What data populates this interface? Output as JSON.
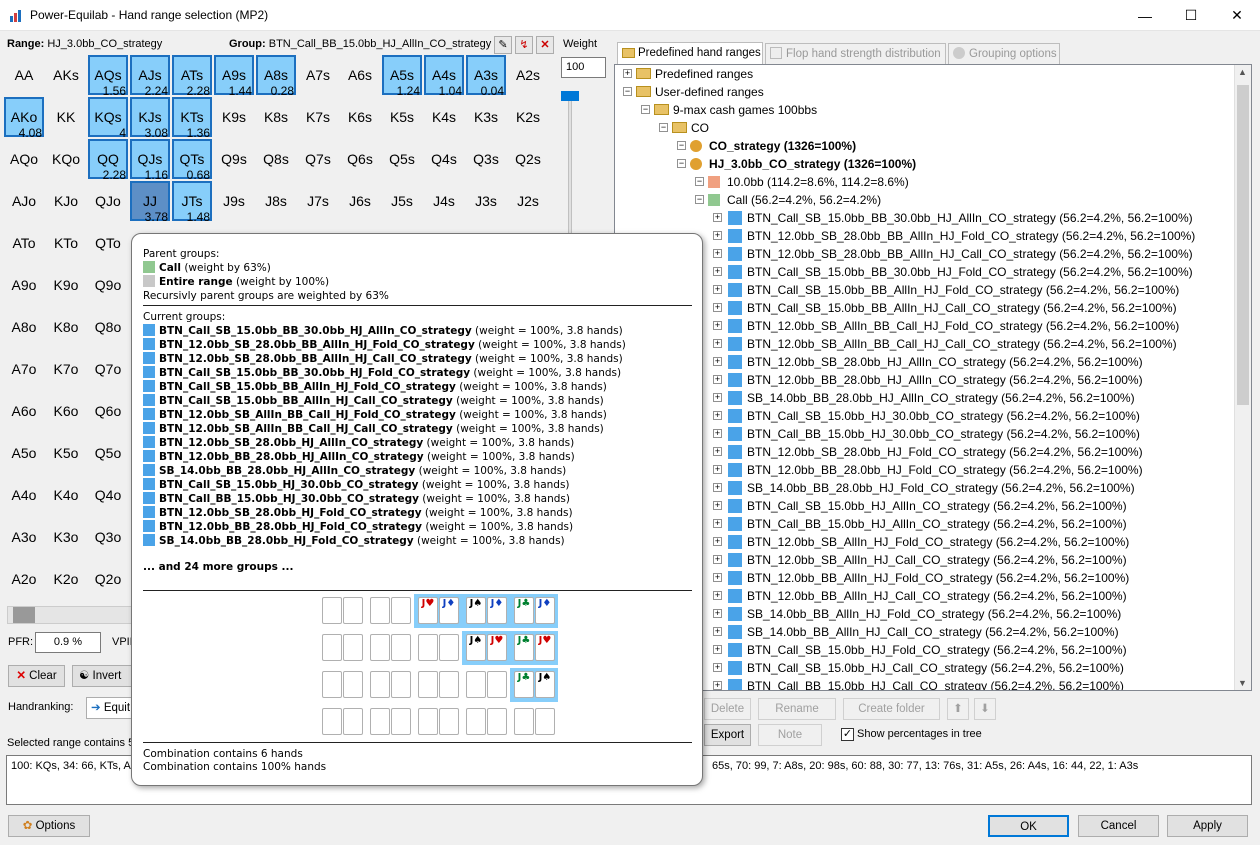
{
  "window": {
    "title": "Power-Equilab - Hand range selection (MP2)",
    "minimize": "—",
    "maximize": "☐",
    "close": "✕"
  },
  "header": {
    "range_label": "Range:",
    "range_value": "HJ_3.0bb_CO_strategy",
    "group_label": "Group:",
    "group_value": "BTN_Call_BB_15.0bb_HJ_AllIn_CO_strategy",
    "weight_label": "Weight",
    "weight_value": "100"
  },
  "grid": [
    [
      "AA",
      "AKs",
      "AQs",
      "AJs",
      "ATs",
      "A9s",
      "A8s",
      "A7s",
      "A6s",
      "A5s",
      "A4s",
      "A3s",
      "A2s"
    ],
    [
      "AKo",
      "KK",
      "KQs",
      "KJs",
      "KTs",
      "K9s",
      "K8s",
      "K7s",
      "K6s",
      "K5s",
      "K4s",
      "K3s",
      "K2s"
    ],
    [
      "AQo",
      "KQo",
      "QQ",
      "QJs",
      "QTs",
      "Q9s",
      "Q8s",
      "Q7s",
      "Q6s",
      "Q5s",
      "Q4s",
      "Q3s",
      "Q2s"
    ],
    [
      "AJo",
      "KJo",
      "QJo",
      "JJ",
      "JTs",
      "J9s",
      "J8s",
      "J7s",
      "J6s",
      "J5s",
      "J4s",
      "J3s",
      "J2s"
    ],
    [
      "ATo",
      "KTo",
      "QTo",
      "",
      "",
      "",
      "",
      "",
      "",
      "",
      "",
      "",
      ""
    ],
    [
      "A9o",
      "K9o",
      "Q9o",
      "",
      "",
      "",
      "",
      "",
      "",
      "",
      "",
      "",
      ""
    ],
    [
      "A8o",
      "K8o",
      "Q8o",
      "",
      "",
      "",
      "",
      "",
      "",
      "",
      "",
      "",
      ""
    ],
    [
      "A7o",
      "K7o",
      "Q7o",
      "",
      "",
      "",
      "",
      "",
      "",
      "",
      "",
      "",
      ""
    ],
    [
      "A6o",
      "K6o",
      "Q6o",
      "",
      "",
      "",
      "",
      "",
      "",
      "",
      "",
      "",
      ""
    ],
    [
      "A5o",
      "K5o",
      "Q5o",
      "",
      "",
      "",
      "",
      "",
      "",
      "",
      "",
      "",
      ""
    ],
    [
      "A4o",
      "K4o",
      "Q4o",
      "",
      "",
      "",
      "",
      "",
      "",
      "",
      "",
      "",
      ""
    ],
    [
      "A3o",
      "K3o",
      "Q3o",
      "",
      "",
      "",
      "",
      "",
      "",
      "",
      "",
      "",
      ""
    ],
    [
      "A2o",
      "K2o",
      "Q2o",
      "",
      "",
      "",
      "",
      "",
      "",
      "",
      "",
      "",
      ""
    ]
  ],
  "selected_cells": [
    {
      "r": 0,
      "c": 2,
      "pct": "1.56"
    },
    {
      "r": 0,
      "c": 3,
      "pct": "2.24"
    },
    {
      "r": 0,
      "c": 4,
      "pct": "2.28"
    },
    {
      "r": 0,
      "c": 5,
      "pct": "1.44"
    },
    {
      "r": 0,
      "c": 6,
      "pct": "0.28"
    },
    {
      "r": 0,
      "c": 9,
      "pct": "1.24"
    },
    {
      "r": 0,
      "c": 10,
      "pct": "1.04"
    },
    {
      "r": 0,
      "c": 11,
      "pct": "0.04"
    },
    {
      "r": 1,
      "c": 0,
      "pct": "4.08"
    },
    {
      "r": 1,
      "c": 2,
      "pct": "4"
    },
    {
      "r": 1,
      "c": 3,
      "pct": "3.08"
    },
    {
      "r": 1,
      "c": 4,
      "pct": "1.36"
    },
    {
      "r": 2,
      "c": 2,
      "pct": "2.28"
    },
    {
      "r": 2,
      "c": 3,
      "pct": "1.16"
    },
    {
      "r": 2,
      "c": 4,
      "pct": "0.68"
    },
    {
      "r": 3,
      "c": 3,
      "pct": "3.78",
      "dark": true
    },
    {
      "r": 3,
      "c": 4,
      "pct": "1.48"
    }
  ],
  "left_controls": {
    "pfr_label": "PFR:",
    "pfr_value": "0.9 %",
    "vpip_label": "VPIP",
    "clear": "Clear",
    "invert": "Invert",
    "handranking_label": "Handranking:",
    "equity": "Equit",
    "selected_text": "Selected range contains 5"
  },
  "popup": {
    "parent_title": "Parent groups:",
    "parents": [
      {
        "name": "Call",
        "suffix": " (weight by 63%)",
        "color": "#90c890"
      },
      {
        "name": "Entire range",
        "suffix": " (weight by 100%)",
        "color": "#c8c8c8"
      }
    ],
    "recursive_note": "Recursivly parent groups are weighted by 63%",
    "current_title": "Current groups:",
    "groups": [
      {
        "name": "BTN_Call_SB_15.0bb_BB_30.0bb_HJ_AllIn_CO_strategy",
        "suffix": " (weight = 100%, 3.8 hands)"
      },
      {
        "name": "BTN_12.0bb_SB_28.0bb_BB_AllIn_HJ_Fold_CO_strategy",
        "suffix": " (weight = 100%, 3.8 hands)"
      },
      {
        "name": "BTN_12.0bb_SB_28.0bb_BB_AllIn_HJ_Call_CO_strategy",
        "suffix": " (weight = 100%, 3.8 hands)"
      },
      {
        "name": "BTN_Call_SB_15.0bb_BB_30.0bb_HJ_Fold_CO_strategy",
        "suffix": " (weight = 100%, 3.8 hands)"
      },
      {
        "name": "BTN_Call_SB_15.0bb_BB_AllIn_HJ_Fold_CO_strategy",
        "suffix": " (weight = 100%, 3.8 hands)"
      },
      {
        "name": "BTN_Call_SB_15.0bb_BB_AllIn_HJ_Call_CO_strategy",
        "suffix": " (weight = 100%, 3.8 hands)"
      },
      {
        "name": "BTN_12.0bb_SB_AllIn_BB_Call_HJ_Fold_CO_strategy",
        "suffix": " (weight = 100%, 3.8 hands)"
      },
      {
        "name": "BTN_12.0bb_SB_AllIn_BB_Call_HJ_Call_CO_strategy",
        "suffix": " (weight = 100%, 3.8 hands)"
      },
      {
        "name": "BTN_12.0bb_SB_28.0bb_HJ_AllIn_CO_strategy",
        "suffix": " (weight = 100%, 3.8 hands)"
      },
      {
        "name": "BTN_12.0bb_BB_28.0bb_HJ_AllIn_CO_strategy",
        "suffix": " (weight = 100%, 3.8 hands)"
      },
      {
        "name": "SB_14.0bb_BB_28.0bb_HJ_AllIn_CO_strategy",
        "suffix": " (weight = 100%, 3.8 hands)"
      },
      {
        "name": "BTN_Call_SB_15.0bb_HJ_30.0bb_CO_strategy",
        "suffix": " (weight = 100%, 3.8 hands)"
      },
      {
        "name": "BTN_Call_BB_15.0bb_HJ_30.0bb_CO_strategy",
        "suffix": " (weight = 100%, 3.8 hands)"
      },
      {
        "name": "BTN_12.0bb_SB_28.0bb_HJ_Fold_CO_strategy",
        "suffix": " (weight = 100%, 3.8 hands)"
      },
      {
        "name": "BTN_12.0bb_BB_28.0bb_HJ_Fold_CO_strategy",
        "suffix": " (weight = 100%, 3.8 hands)"
      },
      {
        "name": "SB_14.0bb_BB_28.0bb_HJ_Fold_CO_strategy",
        "suffix": " (weight = 100%, 3.8 hands)"
      }
    ],
    "more": "... and 24 more groups ...",
    "footer1": "Combination contains 6 hands",
    "footer2": "Combination contains 100% hands"
  },
  "tabs": [
    {
      "label": "Predefined hand ranges"
    },
    {
      "label": "Flop hand strength distribution"
    },
    {
      "label": "Grouping options"
    }
  ],
  "tree": {
    "top": [
      {
        "label": "Predefined ranges",
        "indent": 0
      },
      {
        "label": "User-defined ranges",
        "indent": 0
      },
      {
        "label": "9-max cash games 100bbs",
        "indent": 1
      },
      {
        "label": "CO",
        "indent": 2
      },
      {
        "label": "CO_strategy (1326=100%)",
        "indent": 3,
        "bold": true
      },
      {
        "label": "HJ_3.0bb_CO_strategy (1326=100%)",
        "indent": 3,
        "bold": true
      },
      {
        "label": "10.0bb (114.2=8.6%, 114.2=8.6%)",
        "indent": 4,
        "color": "#f0a080"
      },
      {
        "label": "Call (56.2=4.2%, 56.2=4.2%)",
        "indent": 4,
        "color": "#90c890"
      }
    ],
    "leaves": [
      "BTN_Call_SB_15.0bb_BB_30.0bb_HJ_AllIn_CO_strategy (56.2=4.2%, 56.2=100%)",
      "BTN_12.0bb_SB_28.0bb_BB_AllIn_HJ_Fold_CO_strategy (56.2=4.2%, 56.2=100%)",
      "BTN_12.0bb_SB_28.0bb_BB_AllIn_HJ_Call_CO_strategy (56.2=4.2%, 56.2=100%)",
      "BTN_Call_SB_15.0bb_BB_30.0bb_HJ_Fold_CO_strategy (56.2=4.2%, 56.2=100%)",
      "BTN_Call_SB_15.0bb_BB_AllIn_HJ_Fold_CO_strategy (56.2=4.2%, 56.2=100%)",
      "BTN_Call_SB_15.0bb_BB_AllIn_HJ_Call_CO_strategy (56.2=4.2%, 56.2=100%)",
      "BTN_12.0bb_SB_AllIn_BB_Call_HJ_Fold_CO_strategy (56.2=4.2%, 56.2=100%)",
      "BTN_12.0bb_SB_AllIn_BB_Call_HJ_Call_CO_strategy (56.2=4.2%, 56.2=100%)",
      "BTN_12.0bb_SB_28.0bb_HJ_AllIn_CO_strategy (56.2=4.2%, 56.2=100%)",
      "BTN_12.0bb_BB_28.0bb_HJ_AllIn_CO_strategy (56.2=4.2%, 56.2=100%)",
      "SB_14.0bb_BB_28.0bb_HJ_AllIn_CO_strategy (56.2=4.2%, 56.2=100%)",
      "BTN_Call_SB_15.0bb_HJ_30.0bb_CO_strategy (56.2=4.2%, 56.2=100%)",
      "BTN_Call_BB_15.0bb_HJ_30.0bb_CO_strategy (56.2=4.2%, 56.2=100%)",
      "BTN_12.0bb_SB_28.0bb_HJ_Fold_CO_strategy (56.2=4.2%, 56.2=100%)",
      "BTN_12.0bb_BB_28.0bb_HJ_Fold_CO_strategy (56.2=4.2%, 56.2=100%)",
      "SB_14.0bb_BB_28.0bb_HJ_Fold_CO_strategy (56.2=4.2%, 56.2=100%)",
      "BTN_Call_SB_15.0bb_HJ_AllIn_CO_strategy (56.2=4.2%, 56.2=100%)",
      "BTN_Call_BB_15.0bb_HJ_AllIn_CO_strategy (56.2=4.2%, 56.2=100%)",
      "BTN_12.0bb_SB_AllIn_HJ_Fold_CO_strategy (56.2=4.2%, 56.2=100%)",
      "BTN_12.0bb_SB_AllIn_HJ_Call_CO_strategy (56.2=4.2%, 56.2=100%)",
      "BTN_12.0bb_BB_AllIn_HJ_Fold_CO_strategy (56.2=4.2%, 56.2=100%)",
      "BTN_12.0bb_BB_AllIn_HJ_Call_CO_strategy (56.2=4.2%, 56.2=100%)",
      "SB_14.0bb_BB_AllIn_HJ_Fold_CO_strategy (56.2=4.2%, 56.2=100%)",
      "SB_14.0bb_BB_AllIn_HJ_Call_CO_strategy (56.2=4.2%, 56.2=100%)",
      "BTN_Call_SB_15.0bb_HJ_Fold_CO_strategy (56.2=4.2%, 56.2=100%)",
      "BTN_Call_SB_15.0bb_HJ_Call_CO_strategy (56.2=4.2%, 56.2=100%)",
      "BTN_Call_BB_15.0bb_HJ_Call_CO_strategy (56.2=4.2%, 56.2=100%)"
    ],
    "leaf_color": "#4aa3e8"
  },
  "tree_buttons": {
    "delete": "Delete",
    "rename": "Rename",
    "create_folder": "Create folder",
    "export": "Export",
    "note": "Note",
    "show_pct": "Show percentages in tree"
  },
  "range_text_left": "100: KQs, 34: 66, KTs, A",
  "range_text_right": "65s, 70: 99, 7: A8s, 20: 98s, 60: 88, 30: 77, 13: 76s, 31: A5s, 26: A4s, 16: 44, 22, 1: A3s",
  "footer": {
    "options": "Options",
    "ok": "OK",
    "cancel": "Cancel",
    "apply": "Apply"
  },
  "cards": {
    "rows": [
      [
        [
          "",
          ""
        ],
        [
          "",
          ""
        ],
        [
          "J♥",
          "J♦"
        ],
        [
          "J♠",
          "J♦"
        ],
        [
          "J♣",
          "J♦"
        ]
      ],
      [
        [
          "",
          ""
        ],
        [
          "",
          ""
        ],
        [
          "",
          ""
        ],
        [
          "J♠",
          "J♥"
        ],
        [
          "J♣",
          "J♥"
        ]
      ],
      [
        [
          "",
          ""
        ],
        [
          "",
          ""
        ],
        [
          "",
          ""
        ],
        [
          "",
          ""
        ],
        [
          "J♣",
          "J♠"
        ]
      ],
      [
        [
          "",
          ""
        ],
        [
          "",
          ""
        ],
        [
          "",
          ""
        ],
        [
          "",
          ""
        ],
        [
          "",
          ""
        ]
      ]
    ],
    "suit_colors": {
      "♥": "#d00000",
      "♦": "#1040c0",
      "♠": "#000000",
      "♣": "#008030"
    }
  }
}
